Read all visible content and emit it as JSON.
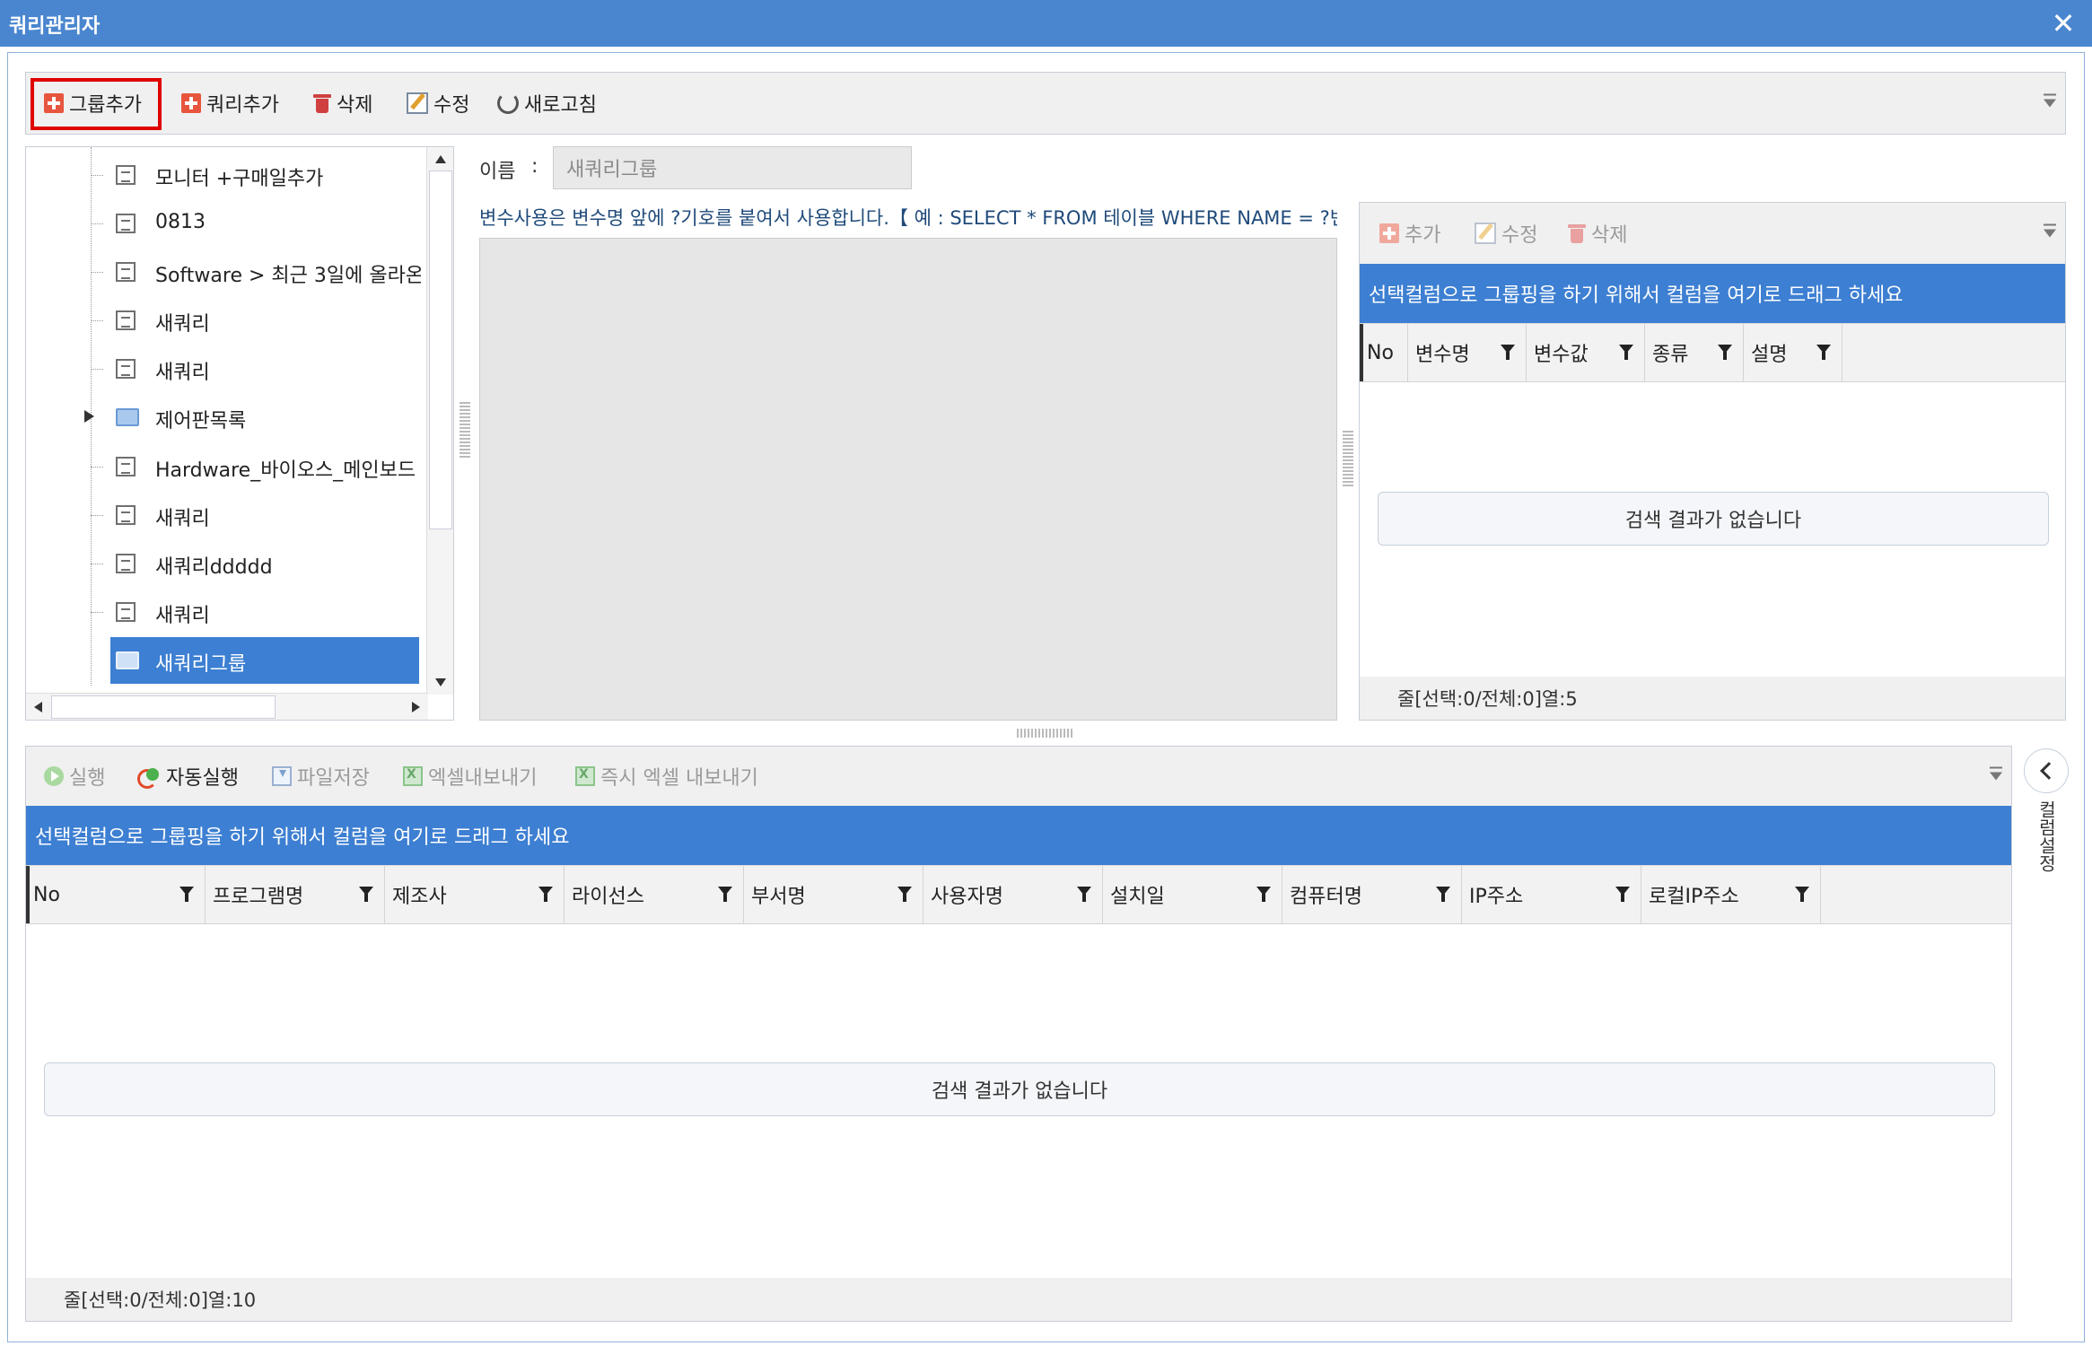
{
  "window": {
    "title": "쿼리관리자",
    "close_glyph": "✕"
  },
  "toolbar": {
    "add_group": "그룹추가",
    "add_query": "쿼리추가",
    "delete": "삭제",
    "edit": "수정",
    "refresh": "새로고침"
  },
  "tree": {
    "items": [
      {
        "label": "모니터 +구매일추가",
        "type": "query"
      },
      {
        "label": "0813",
        "type": "query"
      },
      {
        "label": "Software >  최근 3일에 올라온",
        "type": "query"
      },
      {
        "label": "새쿼리",
        "type": "query"
      },
      {
        "label": "새쿼리",
        "type": "query"
      },
      {
        "label": "제어판목록",
        "type": "folder"
      },
      {
        "label": "Hardware_바이오스_메인보드",
        "type": "query"
      },
      {
        "label": "새쿼리",
        "type": "query"
      },
      {
        "label": "새쿼리ddddd",
        "type": "query"
      },
      {
        "label": "새쿼리",
        "type": "query"
      },
      {
        "label": "새쿼리그룹",
        "type": "folder",
        "selected": true
      }
    ]
  },
  "form": {
    "name_label": "이름",
    "name_colon": ":",
    "name_value": "새쿼리그룹",
    "hint": "변수사용은 변수명 앞에 ?기호를 붙여서 사용합니다.【 예 : SELECT * FROM 테이블 WHERE NAME = ?변수명 】"
  },
  "var_panel": {
    "toolbar": {
      "add": "추가",
      "edit": "수정",
      "delete": "삭제"
    },
    "group_bar": "선택컬럼으로 그룹핑을 하기 위해서 컬럼을 여기로 드래그 하세요",
    "columns": [
      "No",
      "변수명",
      "변수값",
      "종류",
      "설명"
    ],
    "empty": "검색 결과가 없습니다",
    "status": "줄[선택:0/전체:0]열:5"
  },
  "result_panel": {
    "toolbar": {
      "run": "실행",
      "auto_run": "자동실행",
      "save_file": "파일저장",
      "excel_export": "엑셀내보내기",
      "instant_excel": "즉시 엑셀 내보내기"
    },
    "group_bar": "선택컬럼으로 그룹핑을 하기 위해서 컬럼을 여기로 드래그 하세요",
    "columns": [
      "No",
      "프로그램명",
      "제조사",
      "라이선스",
      "부서명",
      "사용자명",
      "설치일",
      "컴퓨터명",
      "IP주소",
      "로컬IP주소"
    ],
    "empty": "검색 결과가 없습니다",
    "status": "줄[선택:0/전체:0]열:10"
  },
  "side": {
    "column_settings": "컬럼설정"
  },
  "colors": {
    "title_bar": "#4a86cf",
    "group_bar": "#3d7fd2",
    "highlight": "#e00000"
  }
}
